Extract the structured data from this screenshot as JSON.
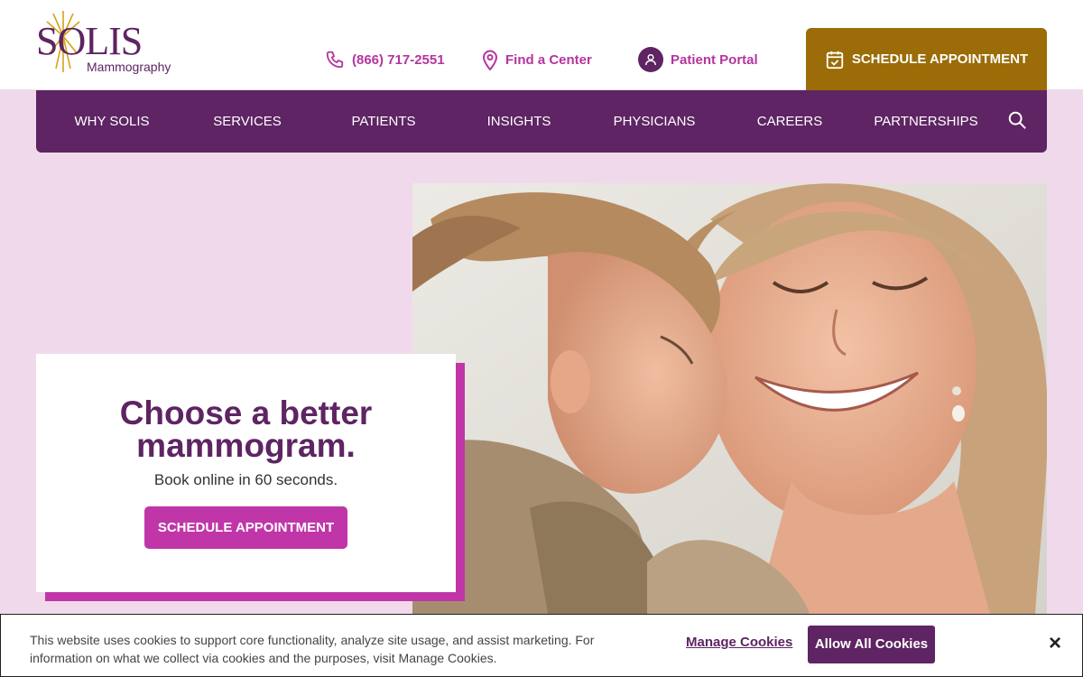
{
  "brand": {
    "name": "SOLIS",
    "subtitle": "Mammography"
  },
  "utility": {
    "phone": "(866) 717-2551",
    "find_center": "Find a Center",
    "patient_portal": "Patient Portal",
    "schedule": "SCHEDULE APPOINTMENT"
  },
  "nav": {
    "items": [
      "WHY SOLIS",
      "SERVICES",
      "PATIENTS",
      "INSIGHTS",
      "PHYSICIANS",
      "CAREERS",
      "PARTNERSHIPS"
    ]
  },
  "hero": {
    "title": "Choose a better mammogram.",
    "subtitle": "Book online in 60 seconds.",
    "button": "SCHEDULE APPOINTMENT"
  },
  "cookie": {
    "text": "This website uses cookies to support core functionality, analyze site usage, and assist marketing. For information on what we collect via cookies and the purposes, visit Manage Cookies.",
    "manage": "Manage Cookies",
    "allow": "Allow All Cookies",
    "close": "×"
  },
  "colors": {
    "brand_purple": "#5e2463",
    "accent_magenta": "#c036a8",
    "gold": "#9b6c07",
    "background_pink": "#f1d9ec"
  },
  "icons": [
    "sun-logo-icon",
    "phone-icon",
    "map-pin-icon",
    "user-icon",
    "calendar-check-icon",
    "search-icon",
    "close-icon"
  ]
}
